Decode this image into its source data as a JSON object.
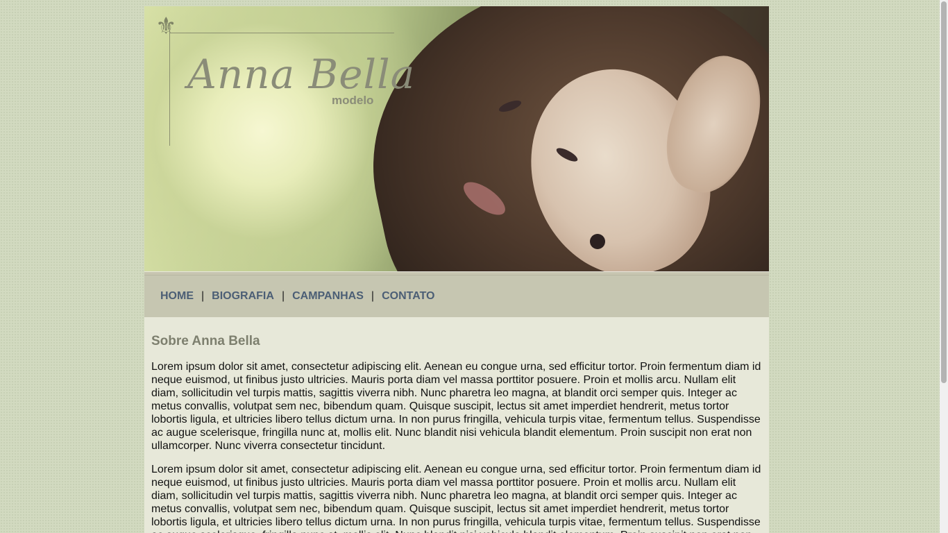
{
  "header": {
    "logo_title": "Anna Bella",
    "logo_subtitle": "modelo",
    "ornament_icon": "fleur-de-lis-icon"
  },
  "nav": {
    "items": [
      {
        "label": "HOME"
      },
      {
        "label": "BIOGRAFIA"
      },
      {
        "label": "CAMPANHAS"
      },
      {
        "label": "CONTATO"
      }
    ],
    "separator": "|"
  },
  "main": {
    "heading": "Sobre Anna Bella",
    "paragraphs": [
      "Lorem ipsum dolor sit amet, consectetur adipiscing elit. Aenean eu congue urna, sed efficitur tortor. Proin fermentum diam id neque euismod, ut finibus justo ultricies. Mauris porta diam vel massa porttitor posuere. Proin et mollis arcu. Nullam elit diam, sollicitudin vel turpis mattis, sagittis viverra nibh. Nunc pharetra leo magna, at blandit orci semper quis. Integer ac metus convallis, volutpat sem nec, bibendum quam. Quisque suscipit, lectus sit amet imperdiet hendrerit, metus tortor lobortis ligula, et ultricies libero tellus dictum urna. In non purus fringilla, vehicula turpis vitae, fermentum tellus. Suspendisse ac augue scelerisque, fringilla nunc at, mollis elit. Nunc blandit nisi vehicula blandit elementum. Proin suscipit non erat non ullamcorper. Nunc viverra consectetur tincidunt.",
      "Lorem ipsum dolor sit amet, consectetur adipiscing elit. Aenean eu congue urna, sed efficitur tortor. Proin fermentum diam id neque euismod, ut finibus justo ultricies. Mauris porta diam vel massa porttitor posuere. Proin et mollis arcu. Nullam elit diam, sollicitudin vel turpis mattis, sagittis viverra nibh. Nunc pharetra leo magna, at blandit orci semper quis. Integer ac metus convallis, volutpat sem nec, bibendum quam. Quisque suscipit, lectus sit amet imperdiet hendrerit, metus tortor lobortis ligula, et ultricies libero tellus dictum urna. In non purus fringilla, vehicula turpis vitae, fermentum tellus. Suspendisse ac augue scelerisque, fringilla nunc at, mollis elit. Nunc blandit nisi vehicula blandit elementum. Proin suscipit non erat non ullamcorper. Nunc viverra consectetur tincidunt."
    ]
  },
  "colors": {
    "background": "#d2dac0",
    "content_bg": "#e7e8d9",
    "nav_bg": "#c6c6b1",
    "nav_link": "#4b5e75",
    "heading": "#7d7f6e"
  }
}
